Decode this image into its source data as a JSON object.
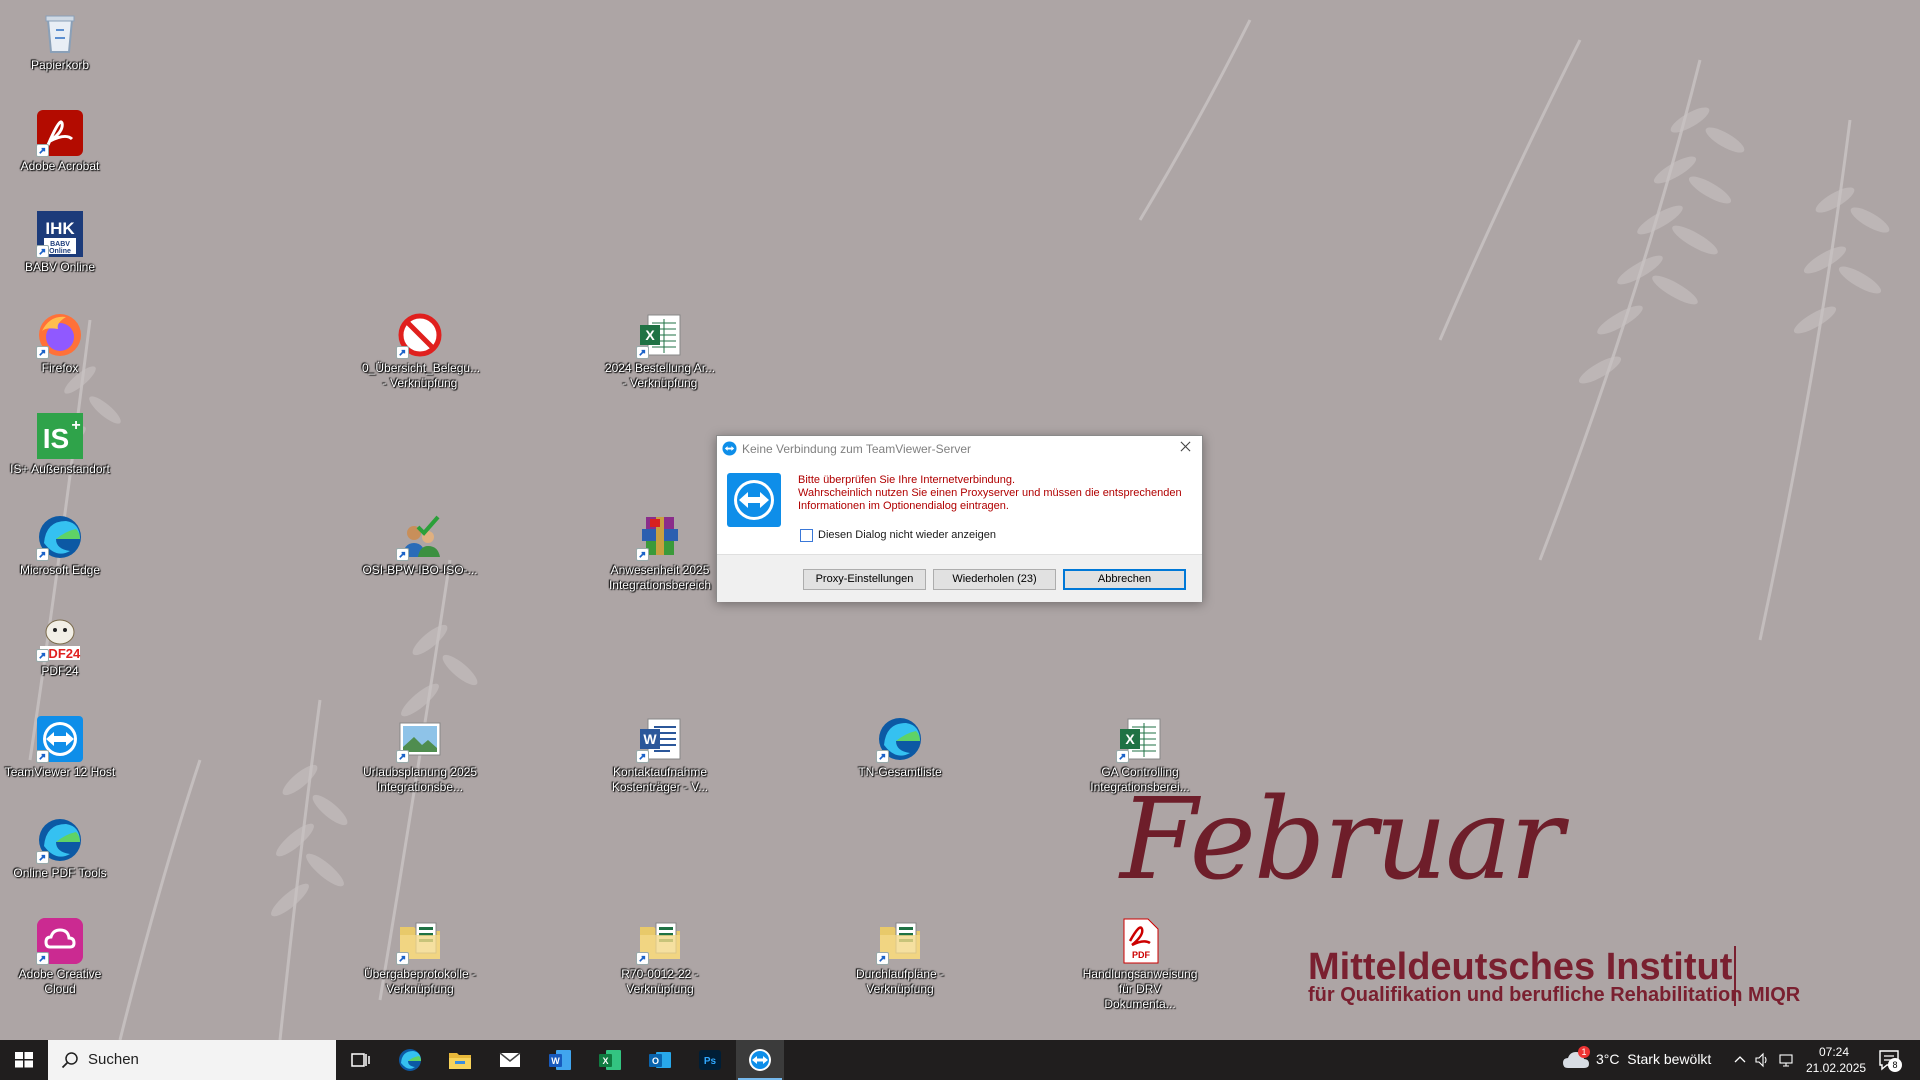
{
  "wallpaper": {
    "month": "Februar",
    "institute": "Mitteldeutsches Institut",
    "subtitle": "für Qualifikation und berufliche Rehabilitation",
    "abbr": "MIQR"
  },
  "desktop_icons": [
    {
      "label": "Papierkorb",
      "icon": "recycle-bin-icon"
    },
    {
      "label": "Adobe Acrobat",
      "icon": "acrobat-icon"
    },
    {
      "label": "BABV Online",
      "icon": "ihk-babv-icon"
    },
    {
      "label": "Firefox",
      "icon": "firefox-icon"
    },
    {
      "label": "IS+ Außenstandort",
      "icon": "is-plus-icon"
    },
    {
      "label": "Microsoft Edge",
      "icon": "edge-icon"
    },
    {
      "label": "PDF24",
      "icon": "pdf24-icon"
    },
    {
      "label": "TeamViewer 12 Host",
      "icon": "teamviewer-icon"
    },
    {
      "label": "Online PDF Tools",
      "icon": "edge-icon"
    },
    {
      "label": "Adobe Creative Cloud",
      "icon": "creative-cloud-icon"
    },
    {
      "label": "0_Übersicht_Belegu... - Verknüpfung",
      "icon": "prohibited-icon"
    },
    {
      "label": "OSI-BPW-IBO-ISO-...",
      "icon": "users-check-icon"
    },
    {
      "label": "Urlaubsplanung 2025 Integrationsbe...",
      "icon": "image-file-icon"
    },
    {
      "label": "Übergabeprotokolle - Verknüpfung",
      "icon": "folder-excel-icon"
    },
    {
      "label": "2024 Bestellung Ar... - Verknüpfung",
      "icon": "excel-file-icon"
    },
    {
      "label": "Anwesenheit 2025 Integrationsbereich",
      "icon": "winrar-icon"
    },
    {
      "label": "Kontaktaufnahme Kostenträger - V...",
      "icon": "word-file-icon"
    },
    {
      "label": "R70-0012-22 - Verknüpfung",
      "icon": "folder-excel-icon"
    },
    {
      "label": "TN-Gesamtliste",
      "icon": "edge-icon"
    },
    {
      "label": "Durchlaufpläne - Verknüpfung",
      "icon": "folder-excel-icon"
    },
    {
      "label": "GA Controlling Integrationsberei...",
      "icon": "excel-file-icon"
    },
    {
      "label": "Handlungsanweisung für DRV Dokumenta...",
      "icon": "pdf-file-icon"
    }
  ],
  "dialog": {
    "title": "Keine Verbindung zum TeamViewer-Server",
    "message_line1": "Bitte überprüfen Sie Ihre Internetverbindung.",
    "message_line2": "Wahrscheinlich nutzen Sie einen Proxyserver und müssen die entsprechenden",
    "message_line3": "Informationen im Optionendialog eintragen.",
    "checkbox_label": "Diesen Dialog nicht wieder anzeigen",
    "checkbox_checked": false,
    "buttons": {
      "proxy": "Proxy-Einstellungen",
      "retry": "Wiederholen (23)",
      "cancel": "Abbrechen"
    }
  },
  "taskbar": {
    "search_placeholder": "Suchen",
    "pinned_apps": [
      "task-view-icon",
      "edge-icon",
      "file-explorer-icon",
      "mail-icon",
      "word-icon",
      "excel-icon",
      "outlook-icon",
      "photoshop-icon",
      "teamviewer-icon"
    ],
    "active_app": "teamviewer-icon",
    "weather": {
      "temp": "3°C",
      "condition": "Stark bewölkt",
      "badge": "1"
    },
    "time": "07:24",
    "date": "21.02.2025",
    "notification_count": "8"
  },
  "colors": {
    "desktop_bg": "#ada5a5",
    "accent": "#0078d7",
    "teamviewer_blue": "#0e8ee9",
    "error_text": "#b00000",
    "brand": "#7a2030"
  }
}
